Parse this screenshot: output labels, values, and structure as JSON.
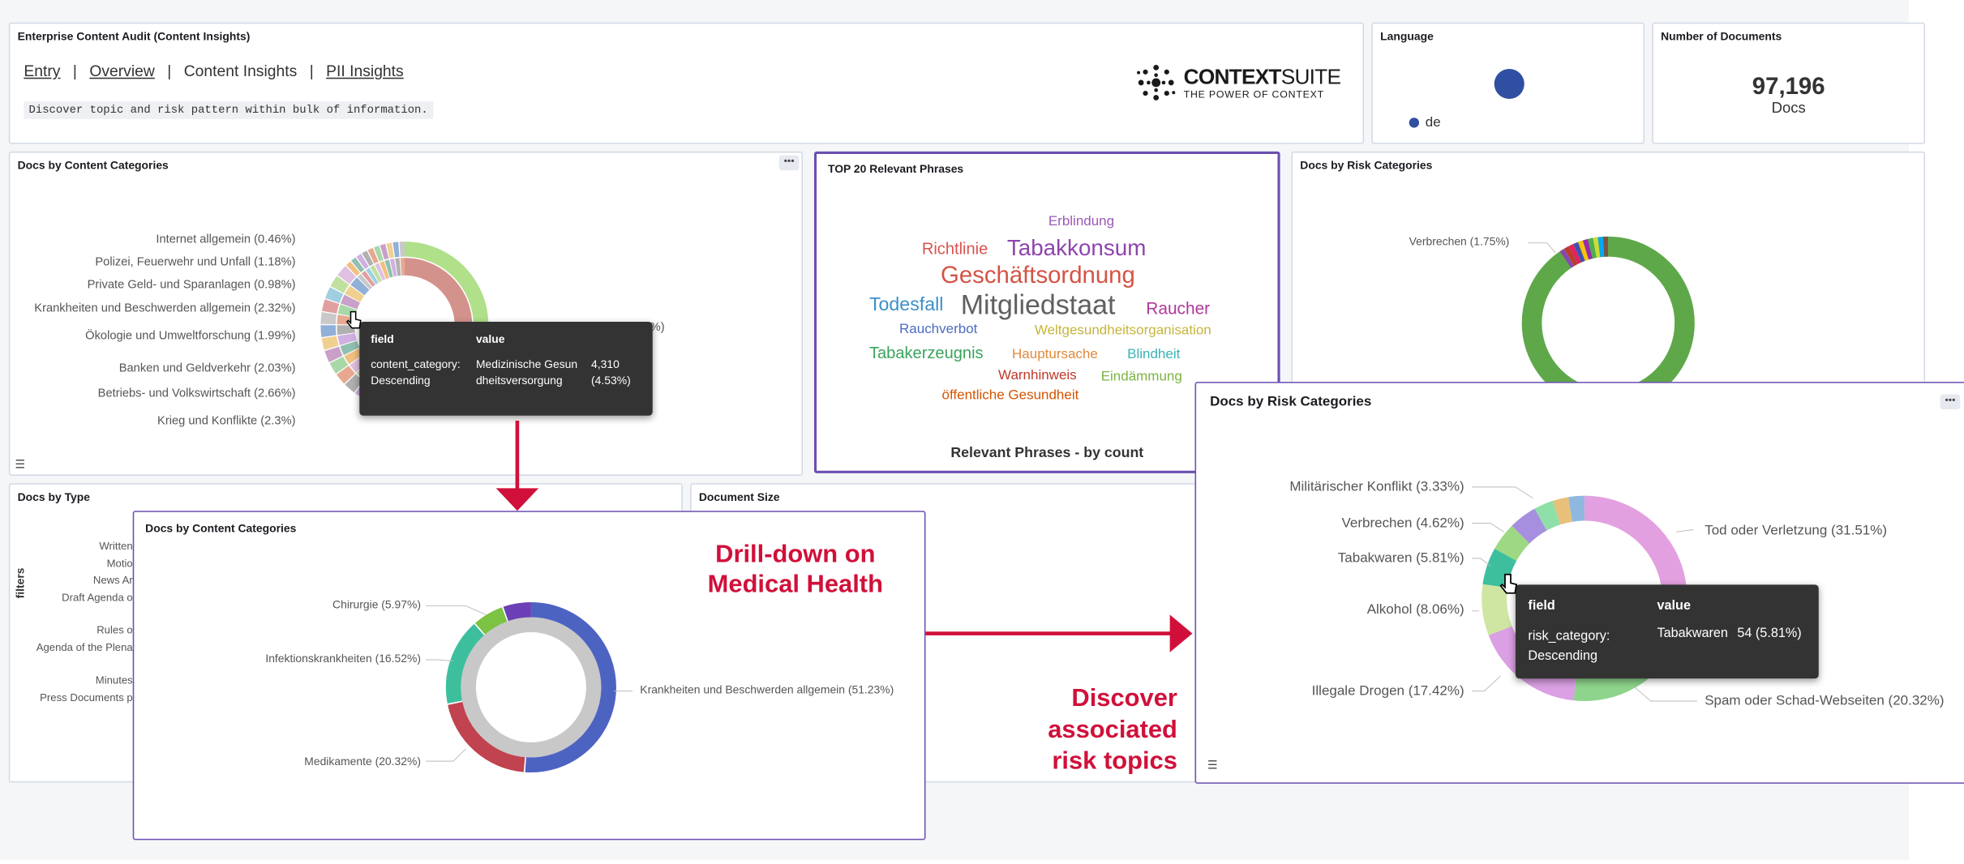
{
  "header": {
    "title": "Enterprise Content Audit (Content Insights)",
    "nav": [
      {
        "label": "Entry",
        "link": true
      },
      {
        "label": "Overview",
        "link": true
      },
      {
        "label": "Content Insights",
        "link": false
      },
      {
        "label": "PII Insights",
        "link": true
      }
    ],
    "description": "Discover topic and risk pattern within bulk of information.",
    "logo": {
      "name": "CONTEXT",
      "name_bold": "SUITE",
      "tagline": "THE POWER OF CONTEXT"
    }
  },
  "language_panel": {
    "title": "Language",
    "legend": "de",
    "color": "#2f4fa2"
  },
  "documents_panel": {
    "title": "Number of Documents",
    "value": "97,196",
    "unit": "Docs"
  },
  "content_categories": {
    "title": "Docs by Content Categories",
    "labels": [
      "Internet allgemein (0.46%)",
      "Polizei, Feuerwehr und Unfall (1.18%)",
      "Private Geld- und Sparanlagen (0.98%)",
      "Krankheiten und Beschwerden allgemein (2.32%)",
      "Ökologie und Umweltforschung (1.99%)",
      "Banken und Geldverkehr (2.03%)",
      "Betriebs- und Volkswirtschaft (2.66%)",
      "Krieg und Konflikte (2.3%)"
    ],
    "partial_label": "%)",
    "tooltip": {
      "head_field": "field",
      "head_value": "value",
      "field": "content_category: Descending",
      "value": "Medizinische Gesundheitsversorgung",
      "count": "4,310 (4.53%)"
    }
  },
  "phrases": {
    "title": "TOP 20 Relevant Phrases",
    "footer": "Relevant Phrases - by count",
    "words": [
      {
        "text": "Erblindung",
        "color": "#9b59b6"
      },
      {
        "text": "Richtlinie",
        "color": "#d9534f"
      },
      {
        "text": "Tabakkonsum",
        "color": "#8e44ad"
      },
      {
        "text": "Geschäftsordnung",
        "color": "#d35445"
      },
      {
        "text": "Todesfall",
        "color": "#3a8fc9"
      },
      {
        "text": "Mitgliedstaat",
        "color": "#606060"
      },
      {
        "text": "Raucher",
        "color": "#b0389a"
      },
      {
        "text": "Rauchverbot",
        "color": "#4b6cc1"
      },
      {
        "text": "Weltgesundheitsorganisation",
        "color": "#c5b53a"
      },
      {
        "text": "Tabakerzeugnis",
        "color": "#3aa35c"
      },
      {
        "text": "Hauptursache",
        "color": "#e08a3c"
      },
      {
        "text": "Blindheit",
        "color": "#3ab3b3"
      },
      {
        "text": "Warnhinweis",
        "color": "#c0392b"
      },
      {
        "text": "Eindämmung",
        "color": "#7cb342"
      },
      {
        "text": "öffentliche Gesundheit",
        "color": "#d35400"
      }
    ]
  },
  "risk_small": {
    "title": "Docs by Risk Categories",
    "label": "Verbrechen (1.75%)"
  },
  "doc_type": {
    "title": "Docs by Type",
    "labels": [
      "Written",
      "Motio",
      "News Ar",
      "Draft Agenda o",
      "Rules o",
      "Agenda of the Plena",
      "Minutes",
      "Press Documents p"
    ],
    "side": "filters"
  },
  "doc_size": {
    "title": "Document Size"
  },
  "drill": {
    "title": "Docs by Content Categories",
    "headline": "Drill-down on Medical Health",
    "labels": [
      "Chirurgie (5.97%)",
      "Infektionskrankheiten (16.52%)",
      "Medikamente (20.32%)",
      "Krankheiten und Beschwerden allgemein (51.23%)"
    ]
  },
  "risk_big": {
    "title": "Docs by Risk Categories",
    "labels": [
      "Militärischer Konflikt (3.33%)",
      "Verbrechen (4.62%)",
      "Tabakwaren (5.81%)",
      "Alkohol (8.06%)",
      "Illegale Drogen (17.42%)",
      "Tod oder Verletzung (31.51%)",
      "Spam oder Schad-Webseiten (20.32%)"
    ],
    "tooltip": {
      "head_field": "field",
      "head_value": "value",
      "field": "risk_category: Descending",
      "value": "Tabakwaren",
      "count": "54 (5.81%)"
    }
  },
  "annotation": {
    "text": "Discover associated risk topics"
  },
  "colors": {
    "accent": "#d0103a",
    "frame": "#6a4fb0",
    "panel_border": "#d3dae6"
  }
}
